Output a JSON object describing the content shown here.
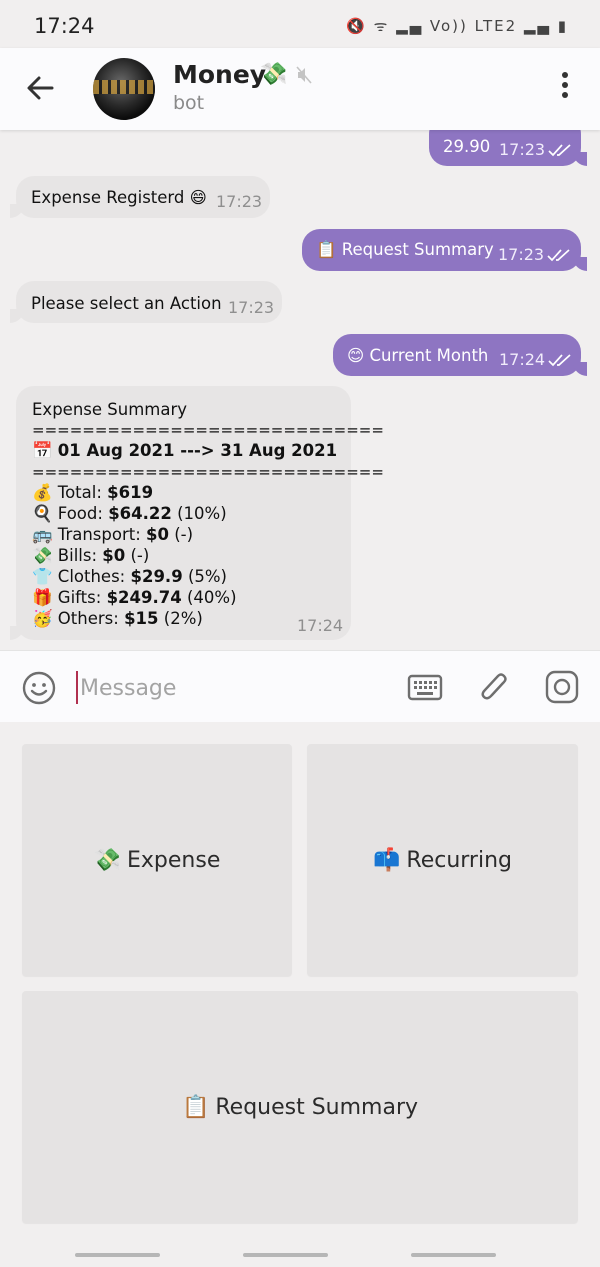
{
  "status_bar": {
    "time": "17:24",
    "icons": "🔇 ᯤ ▂▄ Vo)) LTE2 ▂▄ ▮"
  },
  "header": {
    "title": "Money",
    "title_emoji": "💸",
    "subtitle": "bot",
    "muted": true
  },
  "messages": [
    {
      "type": "out",
      "text": "29.90",
      "time": "17:23"
    },
    {
      "type": "in",
      "text": "Expense Registerd 😄",
      "time": "17:23"
    },
    {
      "type": "out",
      "text": "📋 Request Summary",
      "time": "17:23"
    },
    {
      "type": "in",
      "text": "Please select an Action",
      "time": "17:23"
    },
    {
      "type": "out",
      "text": "😊 Current Month",
      "time": "17:24"
    }
  ],
  "summary": {
    "title": "Expense Summary",
    "separator": "============================",
    "date_range": "01 Aug 2021 ---> 31 Aug 2021",
    "items": [
      {
        "icon": "💰",
        "label": "Total:",
        "value": "$619",
        "pct": ""
      },
      {
        "icon": "🍳",
        "label": "Food:",
        "value": "$64.22",
        "pct": "(10%)"
      },
      {
        "icon": "🚌",
        "label": "Transport:",
        "value": "$0",
        "pct": "(-)"
      },
      {
        "icon": "💸",
        "label": "Bills:",
        "value": "$0",
        "pct": "(-)"
      },
      {
        "icon": "👕",
        "label": "Clothes:",
        "value": "$29.9",
        "pct": "(5%)"
      },
      {
        "icon": "🎁",
        "label": "Gifts:",
        "value": "$249.74",
        "pct": "(40%)"
      },
      {
        "icon": "🥳",
        "label": "Others:",
        "value": "$15",
        "pct": "(2%)"
      }
    ],
    "time": "17:24"
  },
  "input": {
    "placeholder": "Message"
  },
  "keyboard": {
    "expense": {
      "icon": "💸",
      "label": "Expense"
    },
    "recurring": {
      "icon": "📫",
      "label": "Recurring"
    },
    "summary": {
      "icon": "📋",
      "label": "Request Summary"
    }
  },
  "colors": {
    "outgoing_bubble": "#8e75c2",
    "incoming_bubble": "#e7e5e5",
    "background": "#f1efef",
    "cursor": "#b0304f"
  }
}
